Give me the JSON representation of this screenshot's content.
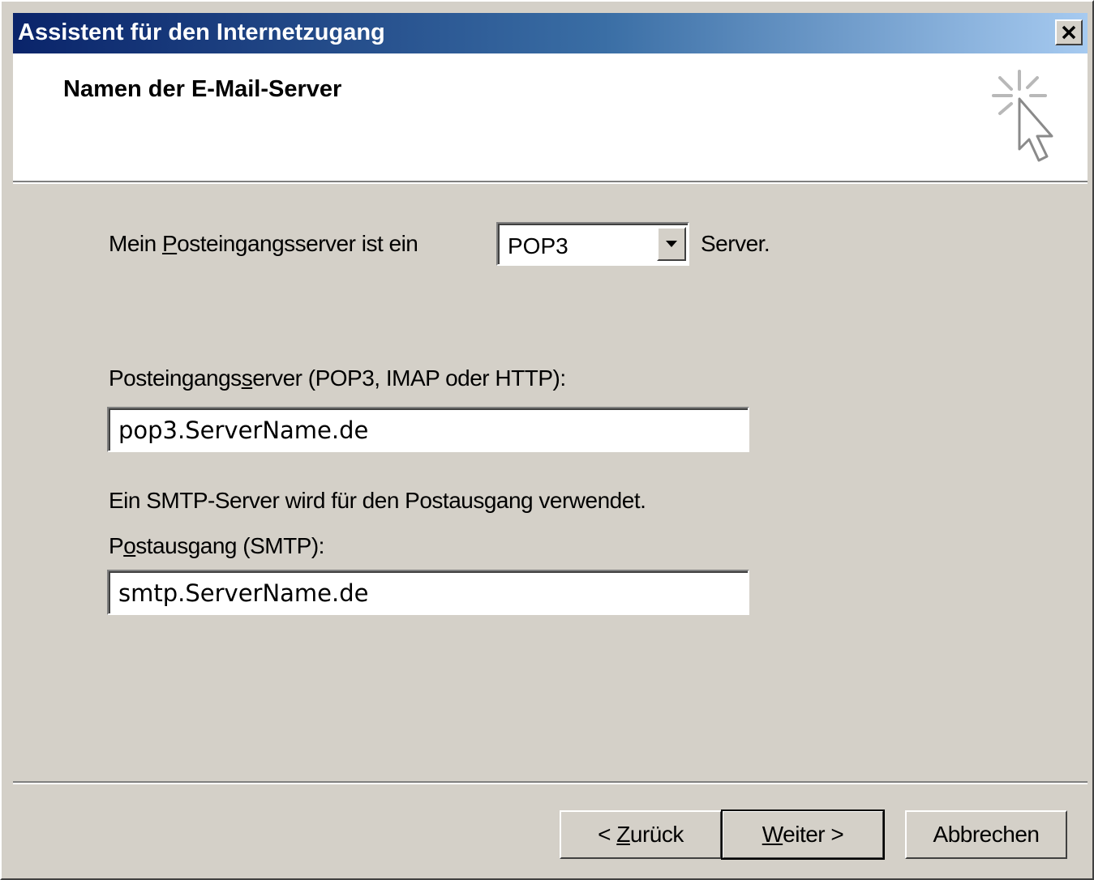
{
  "window": {
    "title": "Assistent für den Internetzugang",
    "close_icon": "close-icon"
  },
  "header": {
    "title": "Namen der E-Mail-Server",
    "icon": "wizard-cursor-icon"
  },
  "incoming_type": {
    "label_before": "Mein ",
    "label_access": "P",
    "label_after": "osteingangsserver ist ein",
    "selected": "POP3",
    "suffix": "Server."
  },
  "incoming_server": {
    "label_before": "Posteingangs",
    "label_access": "s",
    "label_after": "erver (POP3, IMAP oder HTTP):",
    "value": "pop3.ServerName.de"
  },
  "smtp_info": "Ein SMTP-Server wird für den Postausgang verwendet.",
  "outgoing_server": {
    "label_before": "P",
    "label_access": "o",
    "label_after": "stausgang (SMTP):",
    "value": "smtp.ServerName.de"
  },
  "buttons": {
    "back_before": "< ",
    "back_access": "Z",
    "back_after": "urück",
    "next_access": "W",
    "next_after": "eiter >",
    "cancel": "Abbrechen"
  },
  "colors": {
    "title_gradient_start": "#0a246a",
    "title_gradient_end": "#a6caf0",
    "dialog_face": "#d4d0c8"
  }
}
